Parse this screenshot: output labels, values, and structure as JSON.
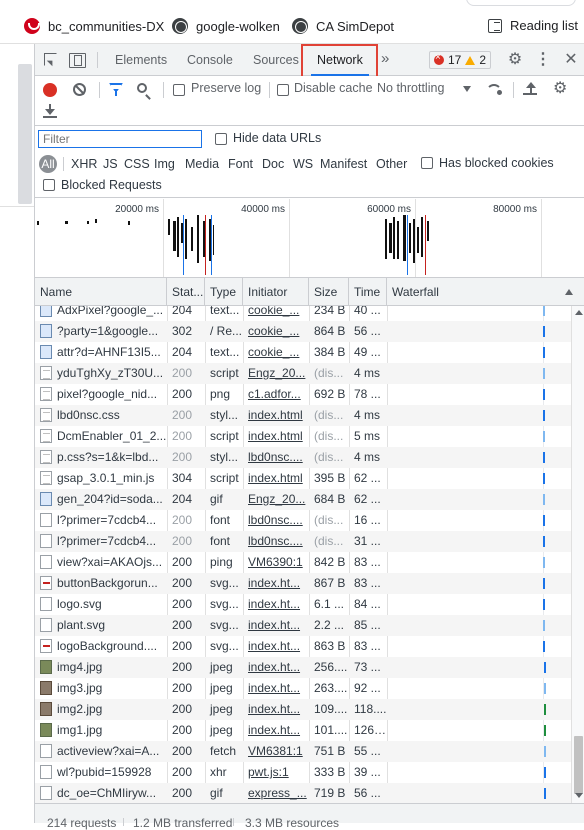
{
  "bookmarks": [
    {
      "label": "bc_communities-DX",
      "icon": "red-logo-icon"
    },
    {
      "label": "google-wolken",
      "icon": "globe-icon"
    },
    {
      "label": "CA SimDepot",
      "icon": "globe-icon"
    },
    {
      "label": "Reading list",
      "icon": "reading-list-icon"
    }
  ],
  "devtools": {
    "tabs": [
      "Elements",
      "Console",
      "Sources",
      "Network"
    ],
    "active_tab": "Network",
    "more_tabs": "»",
    "error_count": "17",
    "warning_count": "2"
  },
  "toolbar": {
    "preserve_log": "Preserve log",
    "disable_cache": "Disable cache",
    "throttling": "No throttling"
  },
  "filter": {
    "placeholder": "Filter",
    "hide_data_urls": "Hide data URLs",
    "types": [
      "All",
      "XHR",
      "JS",
      "CSS",
      "Img",
      "Media",
      "Font",
      "Doc",
      "WS",
      "Manifest",
      "Other"
    ],
    "has_blocked_cookies": "Has blocked cookies",
    "blocked_requests": "Blocked Requests"
  },
  "overview": {
    "ticks": [
      "20000 ms",
      "40000 ms",
      "60000 ms",
      "80000 ms"
    ]
  },
  "table": {
    "headers": [
      "Name",
      "Stat...",
      "Type",
      "Initiator",
      "Size",
      "Time",
      "Waterfall"
    ],
    "rows": [
      {
        "name": "AdxPixel?google_...",
        "status": "204",
        "type": "text...",
        "initiator": "cookie_...",
        "size": "234 B",
        "time": "40 ...",
        "icon": "imgblue",
        "dim": false
      },
      {
        "name": "?party=1&google...",
        "status": "302",
        "type": "/ Re...",
        "initiator": "cookie_...",
        "size": "864 B",
        "time": "56 ...",
        "icon": "imgblue",
        "dim": false
      },
      {
        "name": "attr?d=AHNF13I5...",
        "status": "204",
        "type": "text...",
        "initiator": "cookie_...",
        "size": "384 B",
        "time": "49 ...",
        "icon": "imgblue",
        "dim": false
      },
      {
        "name": "yduTghXy_zT30U...",
        "status": "200",
        "type": "script",
        "initiator": "Engz_20...",
        "size": "(dis...",
        "time": "4 ms",
        "icon": "doc",
        "dim": true
      },
      {
        "name": "pixel?google_nid...",
        "status": "200",
        "type": "png",
        "initiator": "c1.adfor...",
        "size": "692 B",
        "time": "78 ...",
        "icon": "doc",
        "dim": false
      },
      {
        "name": "lbd0nsc.css",
        "status": "200",
        "type": "styl...",
        "initiator": "index.html",
        "size": "(dis...",
        "time": "4 ms",
        "icon": "doc",
        "dim": true
      },
      {
        "name": "DcmEnabler_01_2...",
        "status": "200",
        "type": "script",
        "initiator": "index.html",
        "size": "(dis...",
        "time": "5 ms",
        "icon": "doc",
        "dim": true
      },
      {
        "name": "p.css?s=1&k=lbd...",
        "status": "200",
        "type": "styl...",
        "initiator": "lbd0nsc....",
        "size": "(dis...",
        "time": "4 ms",
        "icon": "doc",
        "dim": true
      },
      {
        "name": "gsap_3.0.1_min.js",
        "status": "304",
        "type": "script",
        "initiator": "index.html",
        "size": "395 B",
        "time": "62 ...",
        "icon": "doc",
        "dim": false
      },
      {
        "name": "gen_204?id=soda...",
        "status": "204",
        "type": "gif",
        "initiator": "Engz_20...",
        "size": "684 B",
        "time": "62 ...",
        "icon": "imgblue",
        "dim": false
      },
      {
        "name": "l?primer=7cdcb4...",
        "status": "200",
        "type": "font",
        "initiator": "lbd0nsc....",
        "size": "(dis...",
        "time": "16 ...",
        "icon": "plain",
        "dim": true
      },
      {
        "name": "l?primer=7cdcb4...",
        "status": "200",
        "type": "font",
        "initiator": "lbd0nsc....",
        "size": "(dis...",
        "time": "31 ...",
        "icon": "plain",
        "dim": true
      },
      {
        "name": "view?xai=AKAOjs...",
        "status": "200",
        "type": "ping",
        "initiator": "VM6390:1",
        "size": "842 B",
        "time": "83 ...",
        "icon": "plain",
        "dim": false
      },
      {
        "name": "buttonBackgorun...",
        "status": "200",
        "type": "svg...",
        "initiator": "index.ht...",
        "size": "867 B",
        "time": "83 ...",
        "icon": "svg-red",
        "dim": false
      },
      {
        "name": "logo.svg",
        "status": "200",
        "type": "svg...",
        "initiator": "index.ht...",
        "size": "6.1 ...",
        "time": "84 ...",
        "icon": "plain",
        "dim": false
      },
      {
        "name": "plant.svg",
        "status": "200",
        "type": "svg...",
        "initiator": "index.ht...",
        "size": "2.2 ...",
        "time": "85 ...",
        "icon": "plain",
        "dim": false
      },
      {
        "name": "logoBackground....",
        "status": "200",
        "type": "svg...",
        "initiator": "index.ht...",
        "size": "863 B",
        "time": "83 ...",
        "icon": "svg-red",
        "dim": false
      },
      {
        "name": "img4.jpg",
        "status": "200",
        "type": "jpeg",
        "initiator": "index.ht...",
        "size": "256....",
        "time": "73 ...",
        "icon": "img",
        "dim": false
      },
      {
        "name": "img3.jpg",
        "status": "200",
        "type": "jpeg",
        "initiator": "index.ht...",
        "size": "263....",
        "time": "92 ...",
        "icon": "img2",
        "dim": false
      },
      {
        "name": "img2.jpg",
        "status": "200",
        "type": "jpeg",
        "initiator": "index.ht...",
        "size": "109....",
        "time": "118....",
        "icon": "img2",
        "dim": false
      },
      {
        "name": "img1.jpg",
        "status": "200",
        "type": "jpeg",
        "initiator": "index.ht...",
        "size": "101....",
        "time": "126....",
        "icon": "img",
        "dim": false
      },
      {
        "name": "activeview?xai=A...",
        "status": "200",
        "type": "fetch",
        "initiator": "VM6381:1",
        "size": "751 B",
        "time": "55 ...",
        "icon": "plain",
        "dim": false
      },
      {
        "name": "wl?pubid=159928",
        "status": "200",
        "type": "xhr",
        "initiator": "pwt.js:1",
        "size": "333 B",
        "time": "39 ...",
        "icon": "plain",
        "dim": false
      },
      {
        "name": "dc_oe=ChMIiryw...",
        "status": "200",
        "type": "gif",
        "initiator": "express_...",
        "size": "719 B",
        "time": "56 ...",
        "icon": "plain",
        "dim": false
      }
    ]
  },
  "status_bar": {
    "requests": "214 requests",
    "transferred": "1.2 MB transferred",
    "resources": "3.3 MB resources"
  }
}
